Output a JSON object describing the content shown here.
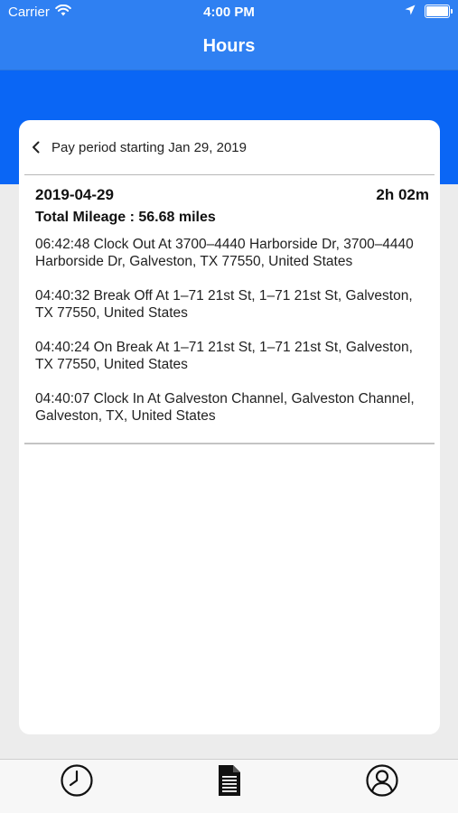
{
  "status_bar": {
    "carrier": "Carrier",
    "time": "4:00 PM",
    "icons": [
      "wifi-icon",
      "location-arrow-icon",
      "battery-icon"
    ]
  },
  "nav": {
    "title": "Hours"
  },
  "pay_period": {
    "label": "Pay period starting Jan 29, 2019",
    "back_icon": "chevron-left-icon"
  },
  "entry": {
    "date": "2019-04-29",
    "duration": "2h 02m",
    "mileage": "Total Mileage : 56.68 miles",
    "events": [
      "06:42:48 Clock Out At 3700–4440 Harborside Dr, 3700–4440 Harborside Dr, Galveston, TX  77550, United States",
      "04:40:32 Break Off At 1–71 21st St, 1–71 21st St, Galveston, TX  77550, United States",
      "04:40:24 On Break At 1–71 21st St, 1–71 21st St, Galveston, TX  77550, United States",
      "04:40:07 Clock In At Galveston Channel, Galveston Channel, Galveston, TX, United States"
    ]
  },
  "tab_bar": {
    "tabs": [
      {
        "icon": "clock-icon",
        "selected": false
      },
      {
        "icon": "document-icon",
        "selected": true
      },
      {
        "icon": "profile-icon",
        "selected": false
      }
    ]
  },
  "colors": {
    "nav_blue": "#2f80f2",
    "band_blue": "#0a66f5",
    "background": "#ececec",
    "card": "#ffffff"
  }
}
